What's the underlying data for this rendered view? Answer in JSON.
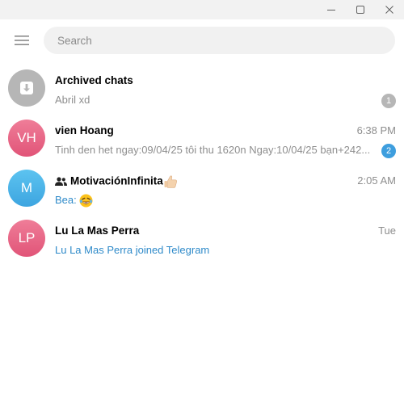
{
  "window": {
    "controls": [
      "minimize-icon",
      "maximize-icon",
      "close-icon"
    ]
  },
  "search": {
    "placeholder": "Search"
  },
  "chats": [
    {
      "id": "archived",
      "avatar_icon": "archive-icon",
      "name": "Archived chats",
      "time": "",
      "preview": "Abril xd",
      "unread": "1",
      "badge_style": "muted"
    },
    {
      "id": "vien-hoang",
      "avatar_initials": "VH",
      "avatar_color": "#e8668a",
      "name": "vien Hoang",
      "time": "6:38 PM",
      "preview": "Tinh den het ngay:09/04/25 tôi thu 1620n Ngay:10/04/25 bạn+242...",
      "unread": "2",
      "badge_style": "active"
    },
    {
      "id": "motivacion",
      "avatar_initials": "M",
      "avatar_color": "#4eb5ea",
      "is_group": true,
      "name": "MotivaciónInfinita",
      "name_emoji": "thumbs-up-emoji",
      "time": "2:05 AM",
      "preview_sender": "Bea:",
      "preview_emoji": "laughing-emoji",
      "preview_color": "#2e8ac9"
    },
    {
      "id": "lu-la-mas-perra",
      "avatar_initials": "LP",
      "avatar_color": "#e8668a",
      "name": "Lu La Mas Perra",
      "time": "Tue",
      "preview": "Lu La Mas Perra joined Telegram",
      "preview_color": "#2e8ac9"
    }
  ]
}
